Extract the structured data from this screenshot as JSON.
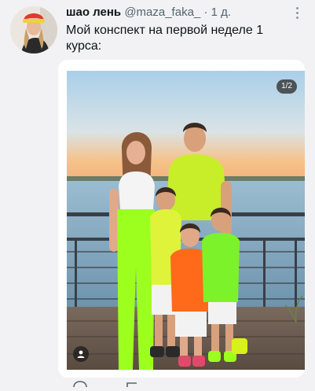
{
  "post": {
    "author_name": "шао лень",
    "author_handle": "@maza_faka_",
    "separator": "·",
    "time": "1 д.",
    "text": "Мой конспект на первой неделе 1 курса:"
  },
  "media": {
    "counter": "1/2"
  },
  "colors": {
    "neon_green": "#9cff1e",
    "orange": "#ff6a1a",
    "sky": "#a9cfe9",
    "sunset": "#f6c28a",
    "text_secondary": "#536471"
  },
  "icons": {
    "more": "more-vertical-icon",
    "person": "person-icon",
    "reply": "reply-icon",
    "retweet": "retweet-icon"
  }
}
